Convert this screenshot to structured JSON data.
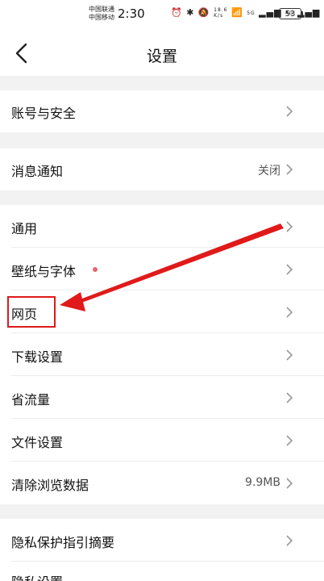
{
  "status_bar": {
    "carrier_1": "中国联通",
    "carrier_2": "中国移动",
    "time": "2:30",
    "net_speed_value": "18.6",
    "net_speed_unit": "K/s",
    "network_5g": "5G",
    "network_4g": "4G",
    "battery": "53"
  },
  "header": {
    "title": "设置"
  },
  "settings": {
    "account_security": "账号与安全",
    "notifications": "消息通知",
    "notifications_value": "关闭",
    "general": "通用",
    "wallpaper_font": "壁纸与字体",
    "webpage": "网页",
    "download_settings": "下载设置",
    "data_saver": "省流量",
    "file_settings": "文件设置",
    "clear_browsing_data": "清除浏览数据",
    "clear_browsing_data_value": "9.9MB",
    "privacy_summary": "隐私保护指引摘要",
    "privacy_settings": "隐私设置"
  },
  "annotation": {
    "highlight_color": "#e01a1a",
    "arrow_color": "#e01a1a"
  },
  "colors": {
    "background": "#f2f2f2",
    "row_background": "#ffffff",
    "dot": "#e8676c"
  }
}
